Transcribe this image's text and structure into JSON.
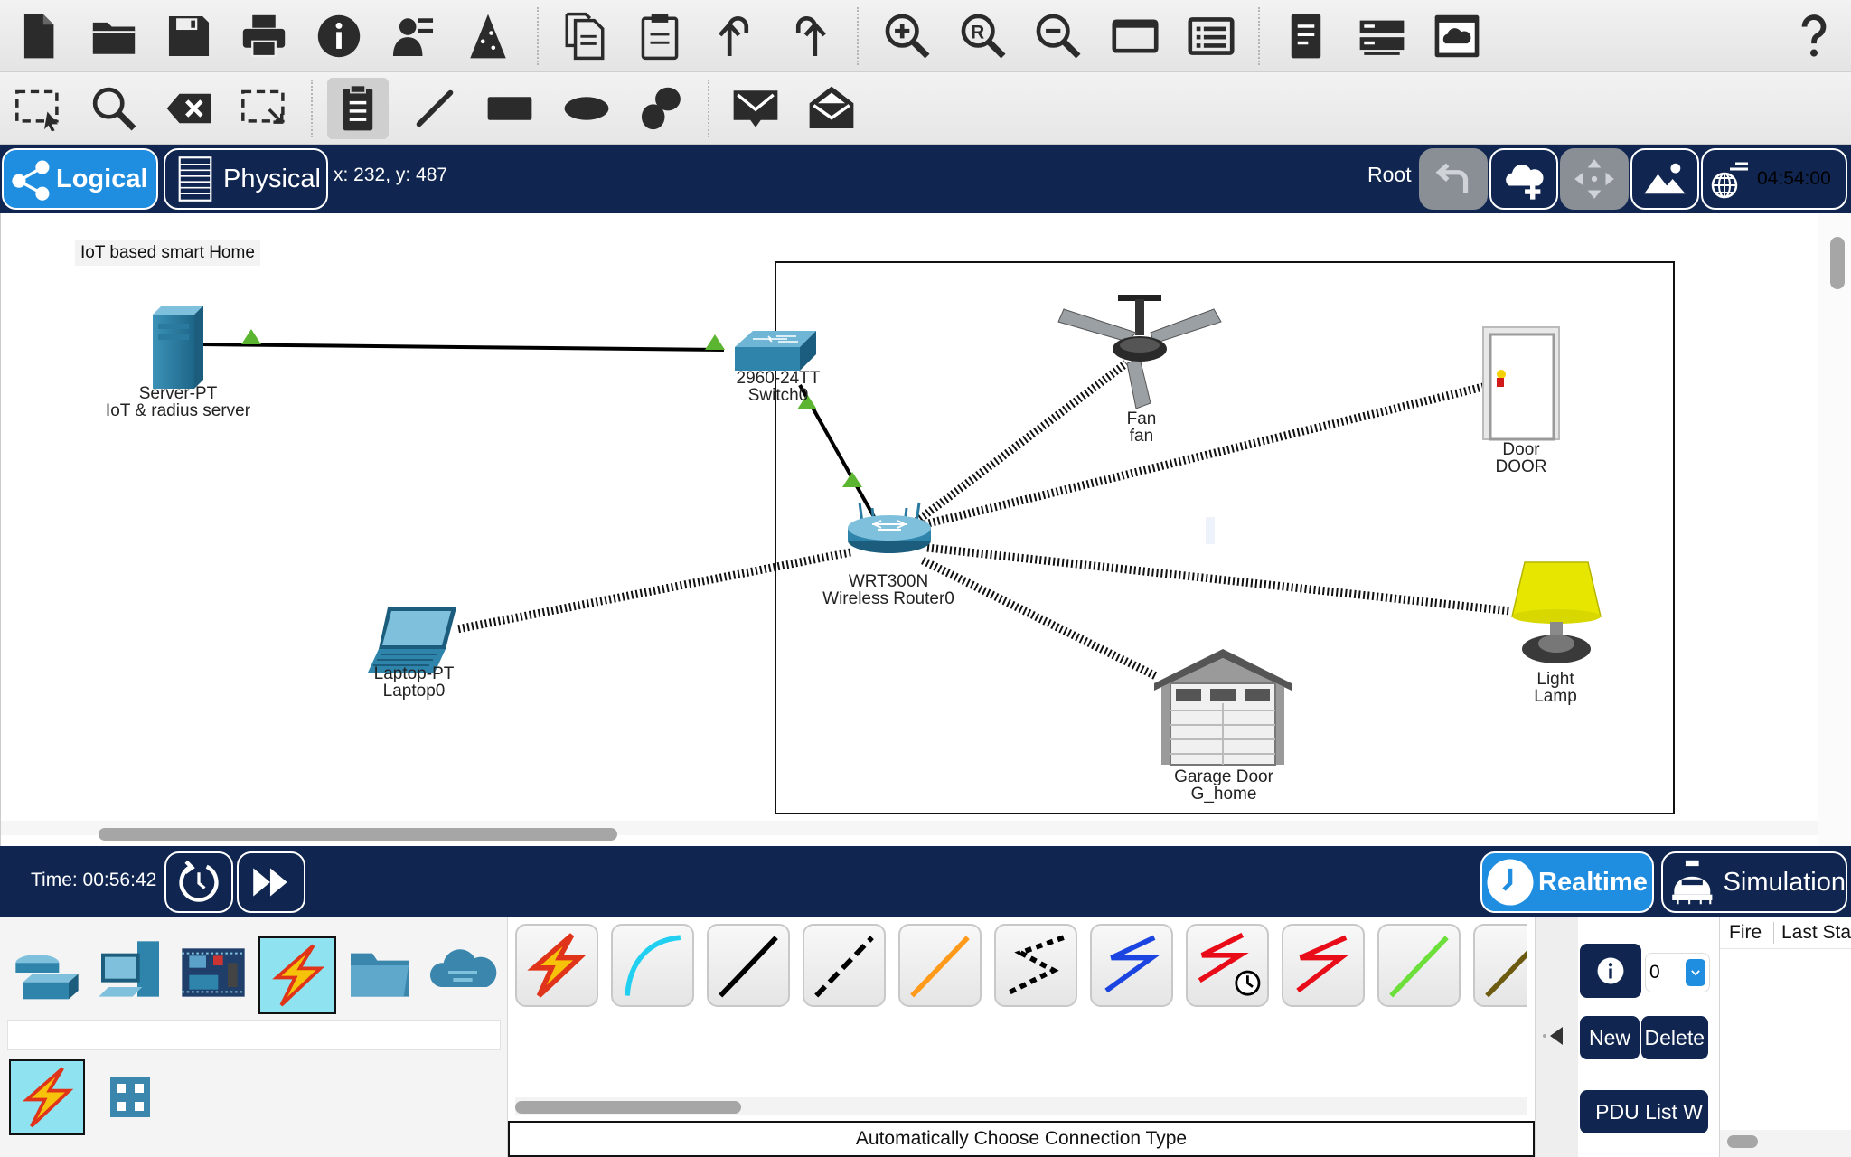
{
  "workspace": {
    "tabs": [
      {
        "label": "Logical"
      },
      {
        "label": "Physical"
      }
    ],
    "cursor_coords": "x: 232, y: 487",
    "root_label": "Root",
    "clock": "04:54:00"
  },
  "canvas": {
    "note": "IoT based smart Home",
    "devices": [
      {
        "model": "Server-PT",
        "name": "IoT & radius server"
      },
      {
        "model": "2960-24TT",
        "name": "Switch0"
      },
      {
        "model": "Fan",
        "name": "fan"
      },
      {
        "model": "Door",
        "name": "DOOR"
      },
      {
        "model": "WRT300N",
        "name": "Wireless Router0"
      },
      {
        "model": "Laptop-PT",
        "name": "Laptop0"
      },
      {
        "model": "Light",
        "name": "Lamp"
      },
      {
        "model": "Garage Door",
        "name": "G_home"
      }
    ]
  },
  "timebar": {
    "time": "Time: 00:56:42",
    "realtime_label": "Realtime",
    "simulation_label": "Simulation"
  },
  "connections_panel": {
    "status": "Automatically Choose Connection Type",
    "cable_icons": [
      "auto-connection-icon",
      "console-cable-icon",
      "straight-through-icon",
      "crossover-icon",
      "fiber-icon",
      "phone-cable-icon",
      "coaxial-icon",
      "serial-dce-icon",
      "serial-dte-icon",
      "octal-cable-icon",
      "iot-custom-cable-icon"
    ]
  },
  "pdu_panel": {
    "scenario_value": "0",
    "new_label": "New",
    "delete_label": "Delete",
    "pdu_list_label": "PDU List W",
    "columns": [
      "Fire",
      "Last Sta"
    ]
  },
  "colors": {
    "navy": "#102650",
    "accent_blue": "#1f8ee0",
    "link_green": "#5cb531"
  }
}
